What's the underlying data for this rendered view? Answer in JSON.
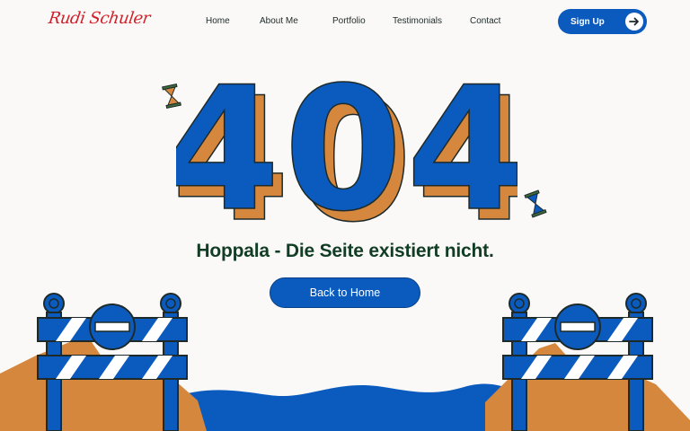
{
  "brand": {
    "logo_text": "Rudi Schuler"
  },
  "nav": {
    "items": [
      {
        "label": "Home"
      },
      {
        "label": "About Me"
      },
      {
        "label": "Portfolio"
      },
      {
        "label": "Testimonials"
      },
      {
        "label": "Contact"
      }
    ],
    "cta_label": "Sign Up"
  },
  "error": {
    "code": "404",
    "message": "Hoppala - Die Seite existiert nicht.",
    "button_label": "Back to Home"
  },
  "colors": {
    "primary_blue": "#0b5bbf",
    "accent_orange": "#d5883d",
    "heading_green": "#123d25",
    "logo_red": "#d1202a",
    "background": "#faf9f7"
  },
  "icons": {
    "cta_icon": "arrow-right-icon",
    "decor": [
      "hourglass-icon",
      "barricade-icon",
      "water-icon"
    ]
  }
}
